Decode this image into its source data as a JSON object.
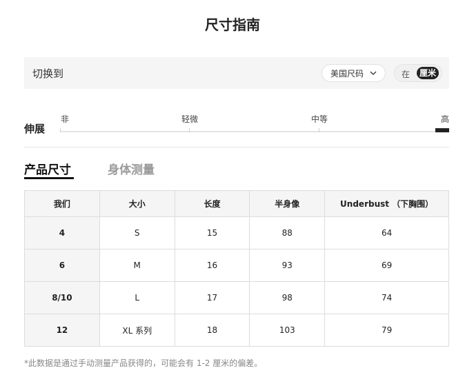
{
  "title": "尺寸指南",
  "switch": {
    "label": "切换到",
    "size_system": "美国尺码",
    "icons": {
      "dropdown": "chevron-down-icon"
    },
    "unit_in": "在",
    "unit_cm": "厘米"
  },
  "stretch": {
    "label": "伸展",
    "scale": [
      "非",
      "轻微",
      "中等",
      "高"
    ],
    "selected": "高"
  },
  "tabs": {
    "product": "产品尺寸",
    "body": "身体测量"
  },
  "table": {
    "headers": [
      "我们",
      "大小",
      "长度",
      "半身像",
      "Underbust （下胸围）"
    ],
    "rows": [
      [
        "4",
        "S",
        "15",
        "88",
        "64"
      ],
      [
        "6",
        "M",
        "16",
        "93",
        "69"
      ],
      [
        "8/10",
        "L",
        "17",
        "98",
        "74"
      ],
      [
        "12",
        "XL 系列",
        "18",
        "103",
        "79"
      ]
    ]
  },
  "footnote": "*此数据是通过手动测量产品获得的，可能会有 1-2 厘米的偏差。",
  "colors": {
    "accent": "#222222",
    "panel": "#f5f5f5",
    "inactive_tab": "#9a9a9a"
  }
}
